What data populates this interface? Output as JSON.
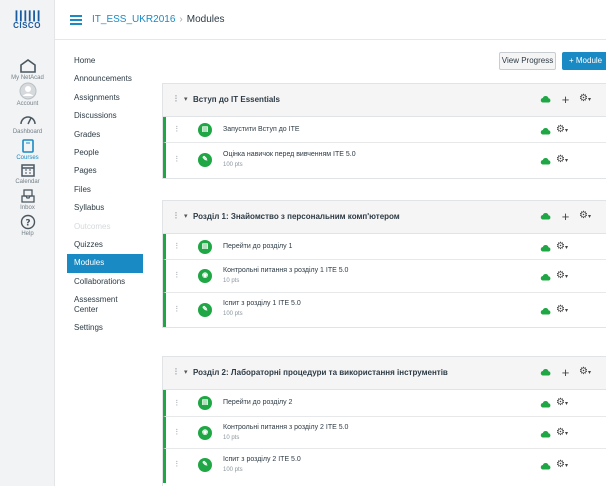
{
  "brand": {
    "bars": "┃┃┃┃┃┃",
    "word": "CISCO"
  },
  "global_nav": [
    {
      "key": "netacad",
      "label": "My NetAcad"
    },
    {
      "key": "account",
      "label": "Account"
    },
    {
      "key": "dashboard",
      "label": "Dashboard"
    },
    {
      "key": "courses",
      "label": "Courses"
    },
    {
      "key": "calendar",
      "label": "Calendar"
    },
    {
      "key": "inbox",
      "label": "Inbox"
    },
    {
      "key": "help",
      "label": "Help"
    }
  ],
  "breadcrumb": {
    "course": "IT_ESS_UKR2016",
    "separator": "›",
    "current": "Modules"
  },
  "course_nav": [
    "Home",
    "Announcements",
    "Assignments",
    "Discussions",
    "Grades",
    "People",
    "Pages",
    "Files",
    "Syllabus",
    "Outcomes",
    "Quizzes",
    "Modules",
    "Collaborations",
    "Assessment Center",
    "Settings"
  ],
  "buttons": {
    "view_progress": "View Progress",
    "add_module": "+ Module"
  },
  "glyphs": {
    "drag": "⠇",
    "chevron": "▾",
    "plus": "+",
    "gear": "⚙",
    "caret": "▾"
  },
  "modules": [
    {
      "title": "Вступ до IT Essentials",
      "items": [
        {
          "type": "page",
          "icon": "▤",
          "title": "Запустити Вступ до ITE",
          "points": ""
        },
        {
          "type": "assignment",
          "icon": "✎",
          "title": "Оцінка навичок перед вивченням ITE 5.0",
          "points": "100 pts"
        }
      ]
    },
    {
      "title": "Розділ 1: Знайомство з персональним комп'ютером",
      "items": [
        {
          "type": "page",
          "icon": "▤",
          "title": "Перейти до розділу 1",
          "points": ""
        },
        {
          "type": "quiz",
          "icon": "◉",
          "title": "Контрольні питання з розділу 1 ITE 5.0",
          "points": "10 pts"
        },
        {
          "type": "assignment",
          "icon": "✎",
          "title": "Іспит з розділу 1 ITE 5.0",
          "points": "100 pts"
        }
      ]
    },
    {
      "title": "Розділ 2: Лабораторні процедури та використання інструментів",
      "items": [
        {
          "type": "page",
          "icon": "▤",
          "title": "Перейти до розділу 2",
          "points": ""
        },
        {
          "type": "quiz",
          "icon": "◉",
          "title": "Контрольні питання з розділу 2 ITE 5.0",
          "points": "10 pts"
        },
        {
          "type": "assignment",
          "icon": "✎",
          "title": "Іспит з розділу 2 ITE 5.0",
          "points": "100 pts"
        }
      ]
    }
  ],
  "colors": {
    "accent": "#1a8ac4",
    "published": "#20a745"
  }
}
